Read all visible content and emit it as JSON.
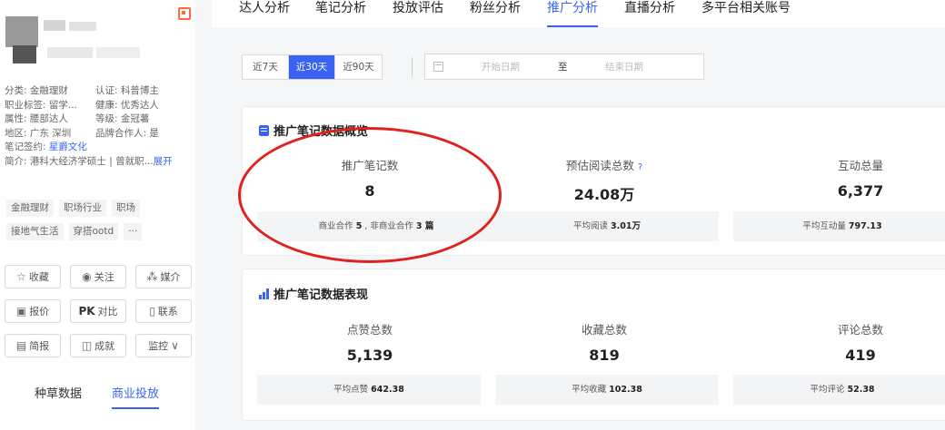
{
  "nav": {
    "items": [
      "达人分析",
      "笔记分析",
      "投放评估",
      "粉丝分析",
      "推广分析",
      "直播分析",
      "多平台相关账号"
    ],
    "active_index": 4
  },
  "sidebar": {
    "info": [
      [
        "分类: 金融理财",
        "认证: 科普博主"
      ],
      [
        "职业标签: 留学...",
        "健康: 优秀达人"
      ],
      [
        "属性: 腰部达人",
        "等级: 金冠薯"
      ],
      [
        "地区: 广东 深圳",
        "品牌合作人: 是"
      ]
    ],
    "contract_label": "笔记签约: ",
    "contract_value": "星爵文化",
    "intro_label": "简介: 港科大经济学硕士 | 曾就职...",
    "intro_expand": "展开",
    "tags_row1": [
      "金融理财",
      "职场行业",
      "职场"
    ],
    "tags_row2": [
      "接地气生活",
      "穿搭ootd",
      "···"
    ],
    "buttons": [
      {
        "icon": "☆",
        "label": "收藏"
      },
      {
        "icon": "◉",
        "label": "关注"
      },
      {
        "icon": "⁂",
        "label": "媒介"
      },
      {
        "icon": "▣",
        "label": "报价"
      },
      {
        "icon": "PK",
        "label": "对比"
      },
      {
        "icon": "▯",
        "label": "联系"
      },
      {
        "icon": "▤",
        "label": "简报"
      },
      {
        "icon": "◫",
        "label": "成就"
      },
      {
        "icon": "∨",
        "label": "监控"
      }
    ],
    "bottom_tabs": [
      "种草数据",
      "商业投放"
    ],
    "bottom_active": 1
  },
  "filters": {
    "ranges": [
      "近7天",
      "近30天",
      "近90天"
    ],
    "active_range": 1,
    "start_placeholder": "开始日期",
    "to": "至",
    "end_placeholder": "结束日期"
  },
  "overview": {
    "title": "推广笔记数据概览",
    "metrics": [
      {
        "label": "推广笔记数",
        "value": "8"
      },
      {
        "label": "预估阅读总数",
        "value": "24.08万",
        "help": "?"
      },
      {
        "label": "互动总量",
        "value": "6,377"
      }
    ],
    "sub": {
      "business_label": "商业合作 ",
      "business_count": "5",
      "sep": " , 非商业合作 ",
      "non_business_count": "3 篇",
      "avg_read_label": "平均阅读 ",
      "avg_read_value": "3.01万",
      "avg_inter_label": "平均互动量 ",
      "avg_inter_value": "797.13"
    }
  },
  "performance": {
    "title": "推广笔记数据表现",
    "metrics": [
      {
        "label": "点赞总数",
        "value": "5,139",
        "avg_label": "平均点赞 ",
        "avg_value": "642.38"
      },
      {
        "label": "收藏总数",
        "value": "819",
        "avg_label": "平均收藏 ",
        "avg_value": "102.38"
      },
      {
        "label": "评论总数",
        "value": "419",
        "avg_label": "平均评论 ",
        "avg_value": "52.38"
      }
    ]
  },
  "colors": {
    "accent": "#3a63f3",
    "annotation": "#e0221e"
  }
}
